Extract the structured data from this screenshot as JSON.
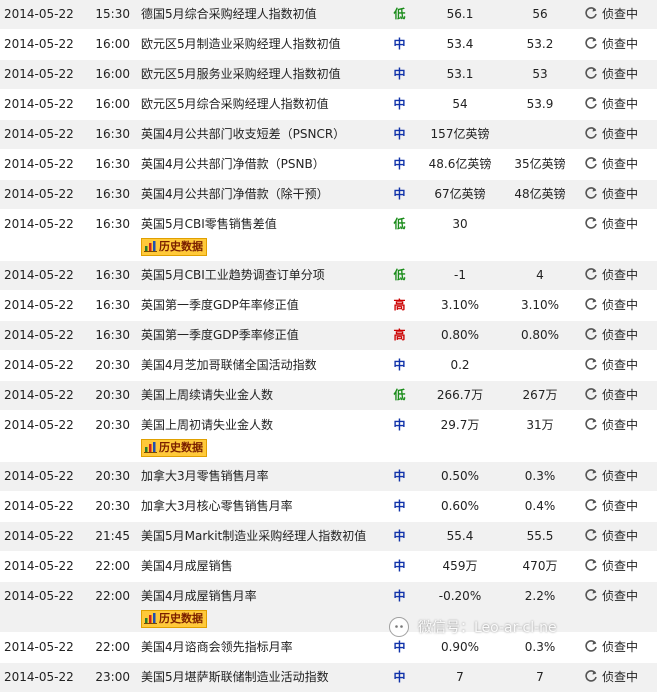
{
  "detail_label": "侦查中",
  "history_label": "历史数据",
  "watermark": "微信号：Leo-ar-cl-ne",
  "colors": {
    "high": "#cc0000",
    "medium": "#1133aa",
    "low": "#1a8c1a",
    "history_bg": "#ffc93a"
  },
  "rows": [
    {
      "date": "2014-05-22",
      "time": "15:30",
      "event": "德国5月综合采购经理人指数初值",
      "importance": "低",
      "level": "low",
      "actual": "56.1",
      "forecast": "56",
      "history": false
    },
    {
      "date": "2014-05-22",
      "time": "16:00",
      "event": "欧元区5月制造业采购经理人指数初值",
      "importance": "中",
      "level": "mid",
      "actual": "53.4",
      "forecast": "53.2",
      "history": false
    },
    {
      "date": "2014-05-22",
      "time": "16:00",
      "event": "欧元区5月服务业采购经理人指数初值",
      "importance": "中",
      "level": "mid",
      "actual": "53.1",
      "forecast": "53",
      "history": false
    },
    {
      "date": "2014-05-22",
      "time": "16:00",
      "event": "欧元区5月综合采购经理人指数初值",
      "importance": "中",
      "level": "mid",
      "actual": "54",
      "forecast": "53.9",
      "history": false
    },
    {
      "date": "2014-05-22",
      "time": "16:30",
      "event": "英国4月公共部门收支短差（PSNCR）",
      "importance": "中",
      "level": "mid",
      "actual": "157亿英镑",
      "forecast": "",
      "history": false
    },
    {
      "date": "2014-05-22",
      "time": "16:30",
      "event": "英国4月公共部门净借款（PSNB）",
      "importance": "中",
      "level": "mid",
      "actual": "48.6亿英镑",
      "forecast": "35亿英镑",
      "history": false
    },
    {
      "date": "2014-05-22",
      "time": "16:30",
      "event": "英国4月公共部门净借款（除干预）",
      "importance": "中",
      "level": "mid",
      "actual": "67亿英镑",
      "forecast": "48亿英镑",
      "history": false
    },
    {
      "date": "2014-05-22",
      "time": "16:30",
      "event": "英国5月CBI零售销售差值",
      "importance": "低",
      "level": "low",
      "actual": "30",
      "forecast": "",
      "history": true
    },
    {
      "date": "2014-05-22",
      "time": "16:30",
      "event": "英国5月CBI工业趋势调查订单分项",
      "importance": "低",
      "level": "low",
      "actual": "-1",
      "forecast": "4",
      "history": false
    },
    {
      "date": "2014-05-22",
      "time": "16:30",
      "event": "英国第一季度GDP年率修正值",
      "importance": "高",
      "level": "high",
      "actual": "3.10%",
      "forecast": "3.10%",
      "history": false
    },
    {
      "date": "2014-05-22",
      "time": "16:30",
      "event": "英国第一季度GDP季率修正值",
      "importance": "高",
      "level": "high",
      "actual": "0.80%",
      "forecast": "0.80%",
      "history": false
    },
    {
      "date": "2014-05-22",
      "time": "20:30",
      "event": "美国4月芝加哥联储全国活动指数",
      "importance": "中",
      "level": "mid",
      "actual": "0.2",
      "forecast": "",
      "history": false
    },
    {
      "date": "2014-05-22",
      "time": "20:30",
      "event": "美国上周续请失业金人数",
      "importance": "低",
      "level": "low",
      "actual": "266.7万",
      "forecast": "267万",
      "history": false
    },
    {
      "date": "2014-05-22",
      "time": "20:30",
      "event": "美国上周初请失业金人数",
      "importance": "中",
      "level": "mid",
      "actual": "29.7万",
      "forecast": "31万",
      "history": true
    },
    {
      "date": "2014-05-22",
      "time": "20:30",
      "event": "加拿大3月零售销售月率",
      "importance": "中",
      "level": "mid",
      "actual": "0.50%",
      "forecast": "0.3%",
      "history": false
    },
    {
      "date": "2014-05-22",
      "time": "20:30",
      "event": "加拿大3月核心零售销售月率",
      "importance": "中",
      "level": "mid",
      "actual": "0.60%",
      "forecast": "0.4%",
      "history": false
    },
    {
      "date": "2014-05-22",
      "time": "21:45",
      "event": "美国5月Markit制造业采购经理人指数初值",
      "importance": "中",
      "level": "mid",
      "actual": "55.4",
      "forecast": "55.5",
      "history": false
    },
    {
      "date": "2014-05-22",
      "time": "22:00",
      "event": "美国4月成屋销售",
      "importance": "中",
      "level": "mid",
      "actual": "459万",
      "forecast": "470万",
      "history": false
    },
    {
      "date": "2014-05-22",
      "time": "22:00",
      "event": "美国4月成屋销售月率",
      "importance": "中",
      "level": "mid",
      "actual": "-0.20%",
      "forecast": "2.2%",
      "history": true
    },
    {
      "date": "2014-05-22",
      "time": "22:00",
      "event": "美国4月谘商会领先指标月率",
      "importance": "中",
      "level": "mid",
      "actual": "0.90%",
      "forecast": "0.3%",
      "history": false
    },
    {
      "date": "2014-05-22",
      "time": "23:00",
      "event": "美国5月堪萨斯联储制造业活动指数",
      "importance": "中",
      "level": "mid",
      "actual": "7",
      "forecast": "7",
      "history": false
    }
  ]
}
